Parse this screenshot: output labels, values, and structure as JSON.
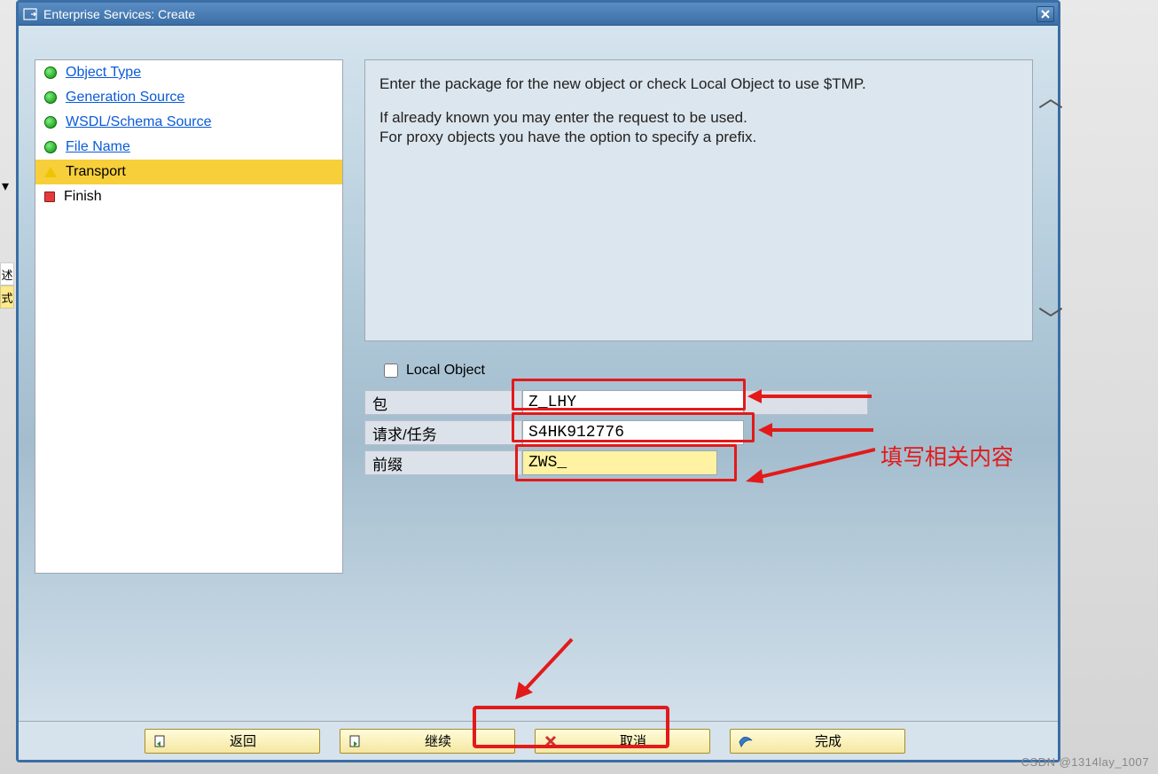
{
  "window": {
    "title": "Enterprise Services: Create"
  },
  "nav": {
    "items": [
      {
        "label": "Object Type",
        "status": "green",
        "link": true
      },
      {
        "label": "Generation Source",
        "status": "green",
        "link": true
      },
      {
        "label": "WSDL/Schema Source",
        "status": "green",
        "link": true
      },
      {
        "label": "File Name",
        "status": "green",
        "link": true
      },
      {
        "label": "Transport",
        "status": "yellow",
        "selected": true
      },
      {
        "label": "Finish",
        "status": "red"
      }
    ]
  },
  "info": {
    "line1": "Enter the package for the new object or check Local Object to use $TMP.",
    "line2": "If already known you may enter the request to be used.",
    "line3": "For proxy objects you have the option to specify a prefix."
  },
  "form": {
    "local_object_label": "Local Object",
    "local_object_checked": false,
    "package_label": "包",
    "package_value": "Z_LHY",
    "request_label": "请求/任务",
    "request_value": "S4HK912776",
    "prefix_label": "前缀",
    "prefix_value": "ZWS_"
  },
  "annotation": {
    "text": "填写相关内容"
  },
  "footer": {
    "back_label": "返回",
    "continue_label": "继续",
    "cancel_label": "取消",
    "finish_label": "完成"
  },
  "behind": {
    "shu": "述",
    "shi": "式"
  },
  "watermark": "CSDN @1314lay_1007"
}
